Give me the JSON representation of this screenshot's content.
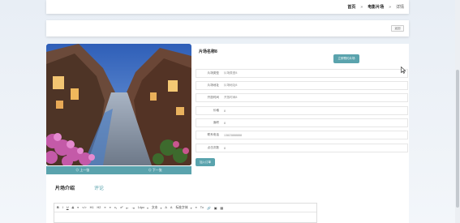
{
  "breadcrumb": {
    "home": "首页",
    "category": "电影片场",
    "current": "详情",
    "separator": "»"
  },
  "toolbar": {
    "back_label": "返回"
  },
  "product": {
    "title": "片场名称8",
    "book_button": "立即预约片场",
    "fields": [
      {
        "label": "片场类型",
        "value": "片场类型8"
      },
      {
        "label": "片场地址",
        "value": "片场地址8"
      },
      {
        "label": "开放时间",
        "value": "开放时间8"
      },
      {
        "label": "价格",
        "value": "8"
      },
      {
        "label": "面积",
        "value": "8"
      },
      {
        "label": "联系电话",
        "value": "13823888888"
      },
      {
        "label": "点击次数",
        "value": "8"
      }
    ],
    "add_to_cart": "加入订单"
  },
  "gallery": {
    "prev_label": "上一张",
    "next_label": "下一张"
  },
  "tabs": {
    "intro": "片场介绍",
    "comment": "评论"
  },
  "editor": {
    "tools": [
      "B",
      "I",
      "U",
      "S",
      "❝",
      "</>",
      "H1",
      "H2",
      "≡",
      "≡",
      "x₂",
      "x²",
      "⇤",
      "⇥"
    ],
    "size_select": "14px",
    "font_select": "文本",
    "tools2": [
      "A",
      "A"
    ],
    "family_select": "标准字体",
    "tools3": [
      "≡",
      "Tx",
      "🔗",
      "▣",
      "▦"
    ]
  },
  "colors": {
    "accent": "#5aa3ad"
  }
}
